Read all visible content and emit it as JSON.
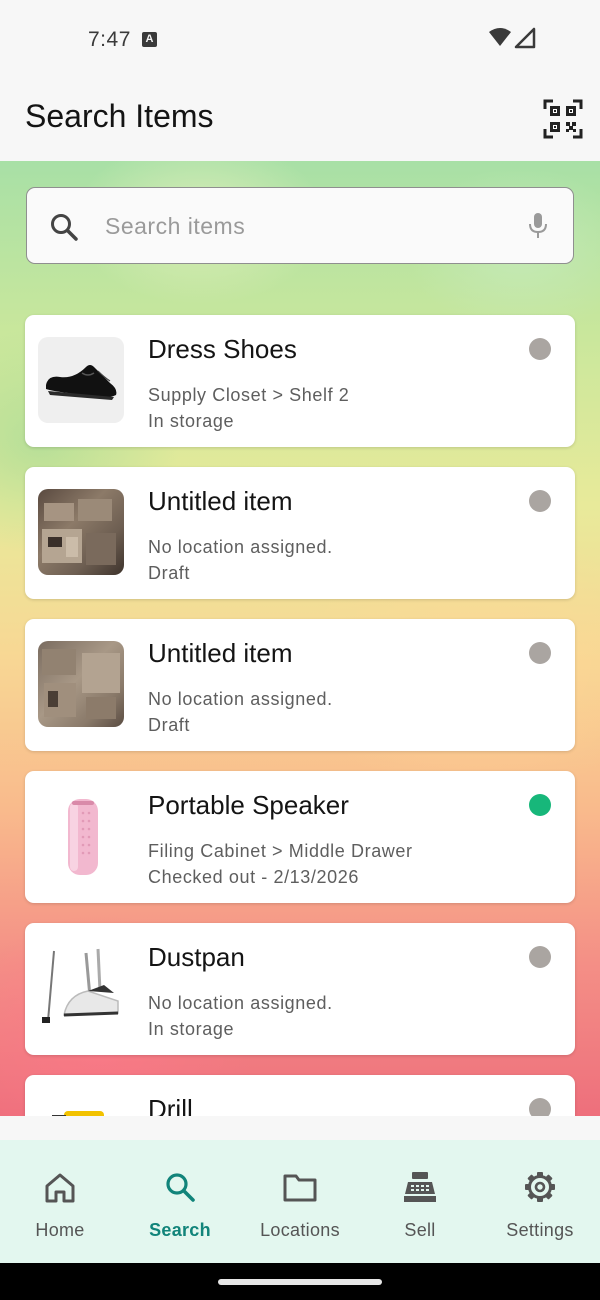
{
  "status_bar": {
    "time": "7:47",
    "notification_badge": "A"
  },
  "app_bar": {
    "title": "Search Items",
    "scan_icon": "qr-scan-icon"
  },
  "search": {
    "placeholder": "Search items",
    "value": ""
  },
  "items": [
    {
      "name": "Dress Shoes",
      "location": "Supply Closet > Shelf 2",
      "status": "In storage",
      "status_color": "#aaa5a1",
      "thumb": "shoe"
    },
    {
      "name": "Untitled item",
      "location": "No location assigned.",
      "status": "Draft",
      "status_color": "#aaa5a1",
      "thumb": "photo"
    },
    {
      "name": "Untitled item",
      "location": "No location assigned.",
      "status": "Draft",
      "status_color": "#aaa5a1",
      "thumb": "photo"
    },
    {
      "name": "Portable Speaker",
      "location": "Filing Cabinet > Middle Drawer",
      "status": "Checked out - 2/13/2026",
      "status_color": "#17b77a",
      "thumb": "speaker"
    },
    {
      "name": "Dustpan",
      "location": "No location assigned.",
      "status": "In storage",
      "status_color": "#aaa5a1",
      "thumb": "dustpan"
    },
    {
      "name": "Drill",
      "location": "",
      "status": "",
      "status_color": "#aaa5a1",
      "thumb": "drill"
    }
  ],
  "nav": [
    {
      "label": "Home",
      "icon": "home-icon",
      "active": false
    },
    {
      "label": "Search",
      "icon": "search-icon",
      "active": true
    },
    {
      "label": "Locations",
      "icon": "folder-icon",
      "active": false
    },
    {
      "label": "Sell",
      "icon": "cash-register-icon",
      "active": false
    },
    {
      "label": "Settings",
      "icon": "gear-icon",
      "active": false
    }
  ],
  "colors": {
    "accent": "#11847a",
    "nav_background": "#e3f7ef",
    "status_gray": "#aaa5a1",
    "status_green": "#17b77a"
  }
}
